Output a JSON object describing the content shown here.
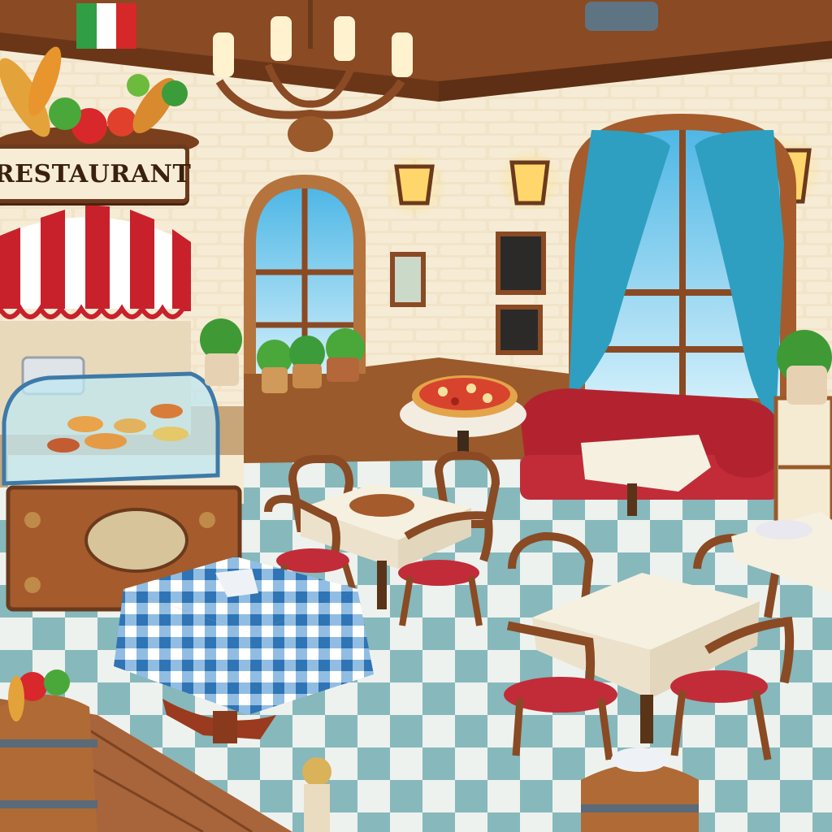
{
  "scene": {
    "sign_text": "RESTAURANT",
    "flag_colors": [
      "#2f9e44",
      "#ffffff",
      "#d62828"
    ],
    "palette": {
      "wall": "#f1e4c8",
      "ceiling": "#8a4a24",
      "floor_light": "#eef2ee",
      "floor_dark": "#7fb3b8",
      "awning_red": "#c8212b",
      "curtain": "#2e9fc0",
      "sofa": "#b3232f",
      "wood": "#9a5a2b",
      "gingham": "#3d86c6"
    }
  }
}
